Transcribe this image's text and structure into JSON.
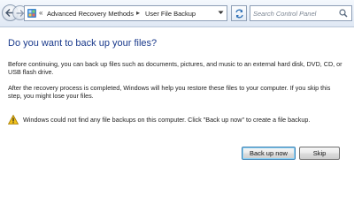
{
  "address_bar": {
    "overflow_chevron": "«",
    "breadcrumbs": [
      "Advanced Recovery Methods",
      "User File Backup"
    ],
    "separator": "▸"
  },
  "search": {
    "placeholder": "Search Control Panel"
  },
  "content": {
    "heading": "Do you want to back up your files?",
    "paragraph1": "Before continuing, you can back up files such as documents, pictures, and music to an external hard disk, DVD, CD, or USB flash drive.",
    "paragraph2": "After the recovery process is completed, Windows will help you restore these files to  your computer.  If you skip this step, you might lose your files.",
    "warning": "Windows could not find any file backups on this computer. Click \"Back up now\" to create a file backup."
  },
  "buttons": {
    "backup": "Back up now",
    "skip": "Skip"
  },
  "colors": {
    "heading": "#1a3a8c",
    "accent_border": "#3c7fb1",
    "warning": "#f2c21a"
  },
  "icons": [
    "back-icon",
    "forward-icon",
    "control-panel-icon",
    "dropdown-icon",
    "refresh-icon",
    "search-icon",
    "warning-icon"
  ]
}
